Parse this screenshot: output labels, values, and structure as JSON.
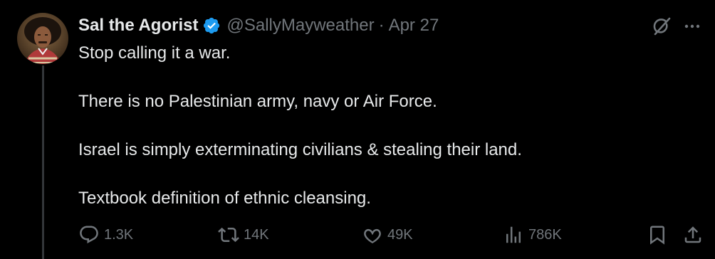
{
  "tweet": {
    "display_name": "Sal the Agorist",
    "handle": "@SallyMayweather",
    "separator": "·",
    "date": "Apr 27",
    "paragraphs": [
      "Stop calling it a war.",
      "There is no Palestinian army, navy or Air Force.",
      "Israel is simply exterminating civilians & stealing their land.",
      "Textbook definition of ethnic cleansing."
    ],
    "verified": true
  },
  "actions": {
    "replies": "1.3K",
    "reposts": "14K",
    "likes": "49K",
    "views": "786K"
  },
  "icons": {
    "verified": "verified-badge-icon",
    "grok": "grok-icon",
    "more": "more-icon",
    "reply": "reply-icon",
    "repost": "repost-icon",
    "like": "heart-icon",
    "views": "views-icon",
    "bookmark": "bookmark-icon",
    "share": "share-icon"
  },
  "colors": {
    "background": "#000000",
    "primary_text": "#e7e9ea",
    "secondary_text": "#71767b",
    "verified_blue": "#1d9bf0",
    "thread_line": "#333639"
  }
}
